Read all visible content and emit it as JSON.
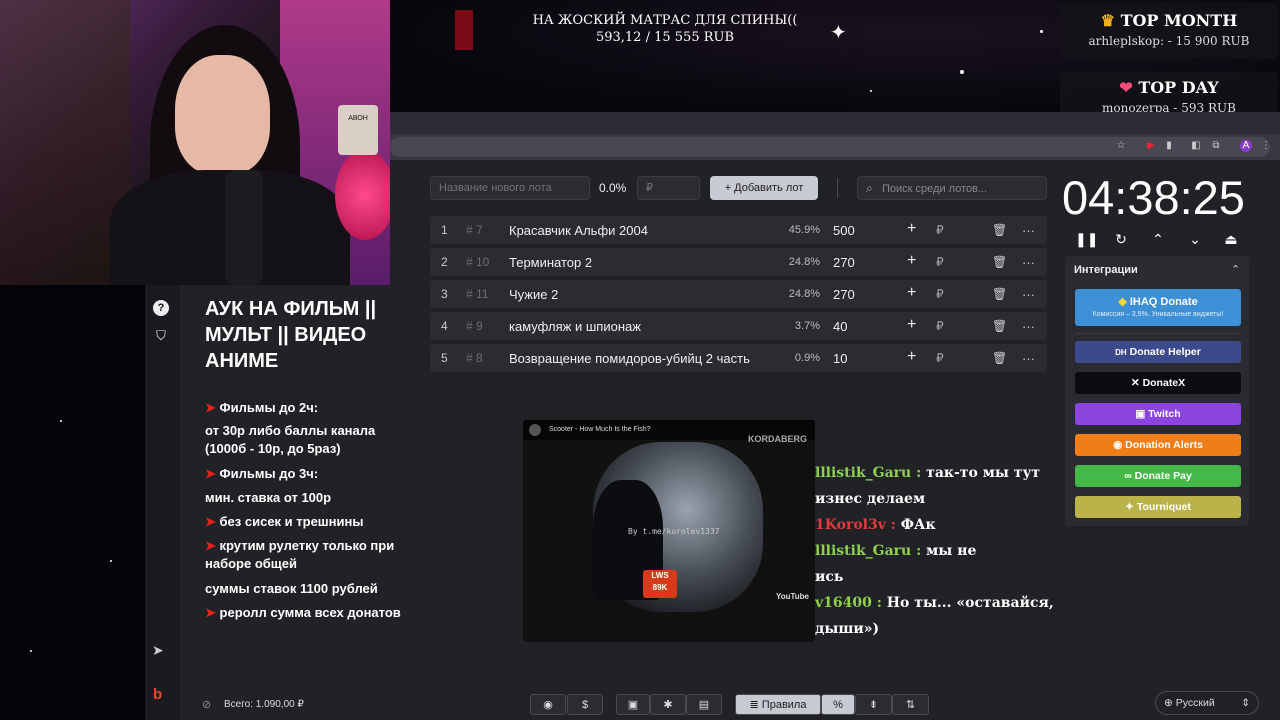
{
  "goal": {
    "line1": "НА ЖОСКИЙ МАТРАС ДЛЯ СПИНЫ((",
    "line2": "593,12 / 15 555 RUB"
  },
  "top_month": {
    "title": "TOP MONTH",
    "text": "arhleplskop:  - 15 900 RUB"
  },
  "top_day": {
    "title": "TOP DAY",
    "text": "monozerpa  - 593 RUB"
  },
  "toolbar": {
    "lot_placeholder": "Название нового лота",
    "percent": "0.0%",
    "amount_placeholder": "₽",
    "add_label": "+  Добавить лот",
    "search_placeholder": "Поиск среди лотов..."
  },
  "lots": [
    {
      "n": "1",
      "id": "# 7",
      "name": "Красавчик Альфи 2004",
      "percent": "45.9%",
      "amount": "500"
    },
    {
      "n": "2",
      "id": "# 10",
      "name": "Терминатор 2",
      "percent": "24.8%",
      "amount": "270"
    },
    {
      "n": "3",
      "id": "# 11",
      "name": "Чужие 2",
      "percent": "24.8%",
      "amount": "270"
    },
    {
      "n": "4",
      "id": "# 9",
      "name": "камуфляж и шпионаж",
      "percent": "3.7%",
      "amount": "40"
    },
    {
      "n": "5",
      "id": "# 8",
      "name": "Возвращение помидоров-убийц 2 часть",
      "percent": "0.9%",
      "amount": "10"
    }
  ],
  "row_icons": {
    "plus": "+",
    "rub": "₽",
    "trash": "🗑",
    "more": "···"
  },
  "info": {
    "title": "АУК НА ФИЛЬМ || МУЛЬТ ||  ВИДЕО АНИМЕ",
    "lines": [
      {
        "arrow": "➤",
        "text": "Фильмы до 2ч:"
      },
      {
        "arrow": "",
        "text": "от 30р либо баллы канала (1000б - 10р, до 5раз)"
      },
      {
        "arrow": "➤",
        "text": "Фильмы до 3ч:"
      },
      {
        "arrow": "",
        "text": "мин. ставка от 100р"
      },
      {
        "arrow": "➤",
        "text": "без сисек и трешнины"
      },
      {
        "arrow": "➤",
        "text": "крутим рулетку только при наборе общей"
      },
      {
        "arrow": "",
        "text": "суммы ставок 1100 рублей"
      },
      {
        "arrow": "➤",
        "text": "реролл сумма всех донатов"
      }
    ]
  },
  "video": {
    "title": "Scooter - How Much Is the Fish?",
    "channel": "KORDABERG",
    "watermark": "By t.me/korolev1337",
    "plate1": "LWS",
    "plate2": "89K",
    "youtube": "YouTube"
  },
  "chat": [
    {
      "user": "lllistik_Garu :",
      "text": " так-то мы тут",
      "cls": "green"
    },
    {
      "user": "",
      "text": "изнес делаем",
      "cls": ""
    },
    {
      "user": "1Korol3v :",
      "text": " ФАк",
      "cls": "red"
    },
    {
      "user": "lllistik_Garu :",
      "text": " мы не",
      "cls": "green"
    },
    {
      "user": "",
      "text": "ись",
      "cls": ""
    },
    {
      "user": "v16400 :",
      "text": " Но ты... «оставайся,",
      "cls": "green"
    },
    {
      "user": "",
      "text": "дыши»)",
      "cls": ""
    }
  ],
  "timer": "04:38:25",
  "integrations": {
    "title": "Интеграции",
    "ihaq": {
      "name": "IHAQ Donate",
      "sub": "Комиссия – 3,5%. Уникальные виджеты!"
    },
    "buttons": [
      {
        "label": "Donate Helper",
        "color": "#3b4a8c",
        "icon": "DH"
      },
      {
        "label": "DonateX",
        "color": "#0c0c10",
        "icon": "✕"
      },
      {
        "label": "Twitch",
        "color": "#8b44e0",
        "icon": "▣"
      },
      {
        "label": "Donation Alerts",
        "color": "#f07d17",
        "icon": "◉"
      },
      {
        "label": "Donate Pay",
        "color": "#45b84a",
        "icon": "∞"
      },
      {
        "label": "Tourniquet",
        "color": "#b9b34a",
        "icon": "✦"
      }
    ]
  },
  "footer": {
    "total": "Всего: 1.090,00 ₽",
    "rules": "Правила",
    "language": "Русский"
  }
}
